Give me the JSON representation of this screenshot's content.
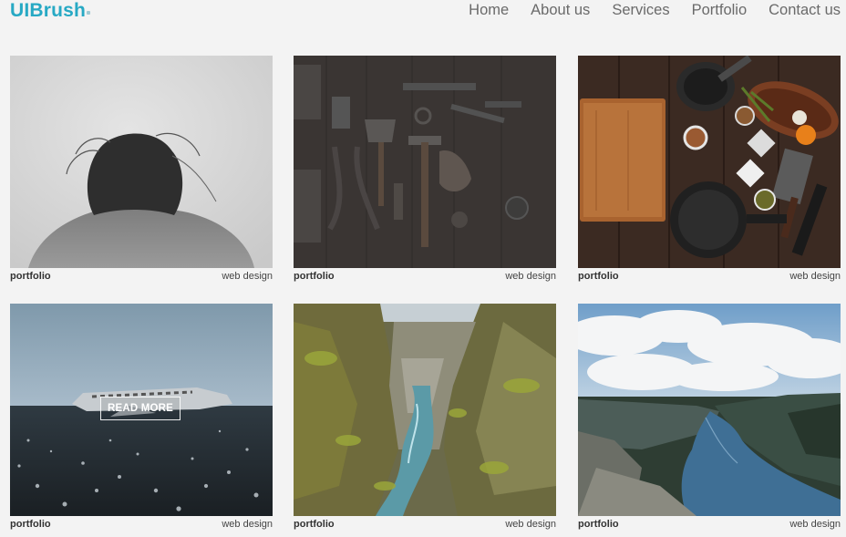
{
  "brand": {
    "logo": "UIBrush"
  },
  "nav": {
    "items": [
      "Home",
      "About us",
      "Services",
      "Portfolio",
      "Contact us"
    ]
  },
  "portfolio": {
    "items": [
      {
        "category": "portfolio",
        "tag": "web design"
      },
      {
        "category": "portfolio",
        "tag": "web design"
      },
      {
        "category": "portfolio",
        "tag": "web design"
      },
      {
        "category": "portfolio",
        "tag": "web design",
        "overlay": "READ MORE"
      },
      {
        "category": "portfolio",
        "tag": "web design"
      },
      {
        "category": "portfolio",
        "tag": "web design"
      }
    ]
  },
  "colors": {
    "brand": "#27a9c4",
    "background": "#f3f3f3",
    "nav_text": "#6a6a6a"
  }
}
